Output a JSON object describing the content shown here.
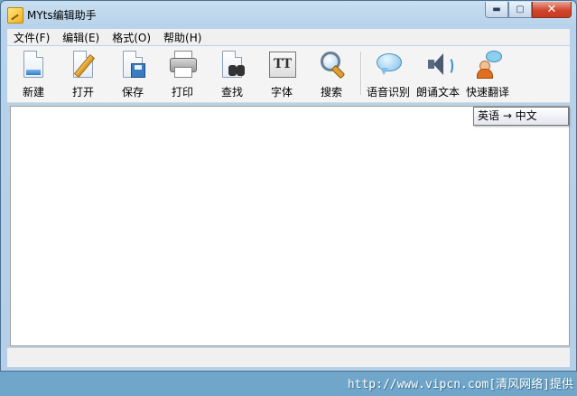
{
  "window": {
    "title": "MYts编辑助手",
    "controls": {
      "minimize": "▬",
      "maximize": "▢",
      "close": "✕"
    }
  },
  "menu": [
    {
      "label": "文件(F)"
    },
    {
      "label": "编辑(E)"
    },
    {
      "label": "格式(O)"
    },
    {
      "label": "帮助(H)"
    }
  ],
  "toolbar": [
    {
      "label": "新建",
      "icon": "new-document-icon"
    },
    {
      "label": "打开",
      "icon": "open-document-icon"
    },
    {
      "label": "保存",
      "icon": "save-disk-icon"
    },
    {
      "label": "打印",
      "icon": "printer-icon"
    },
    {
      "label": "查找",
      "icon": "binoculars-icon"
    },
    {
      "label": "字体",
      "icon": "font-tt-icon"
    },
    {
      "label": "搜索",
      "icon": "magnifier-icon"
    },
    {
      "label": "语音识别",
      "icon": "speech-bubble-icon"
    },
    {
      "label": "朗诵文本",
      "icon": "speaker-icon"
    },
    {
      "label": "快速翻译",
      "icon": "translate-person-icon"
    }
  ],
  "tooltip": {
    "text": "英语 → 中文"
  },
  "editor": {
    "content": ""
  },
  "watermark": {
    "text": "http://www.vipcn.com[清风网络]提供"
  }
}
